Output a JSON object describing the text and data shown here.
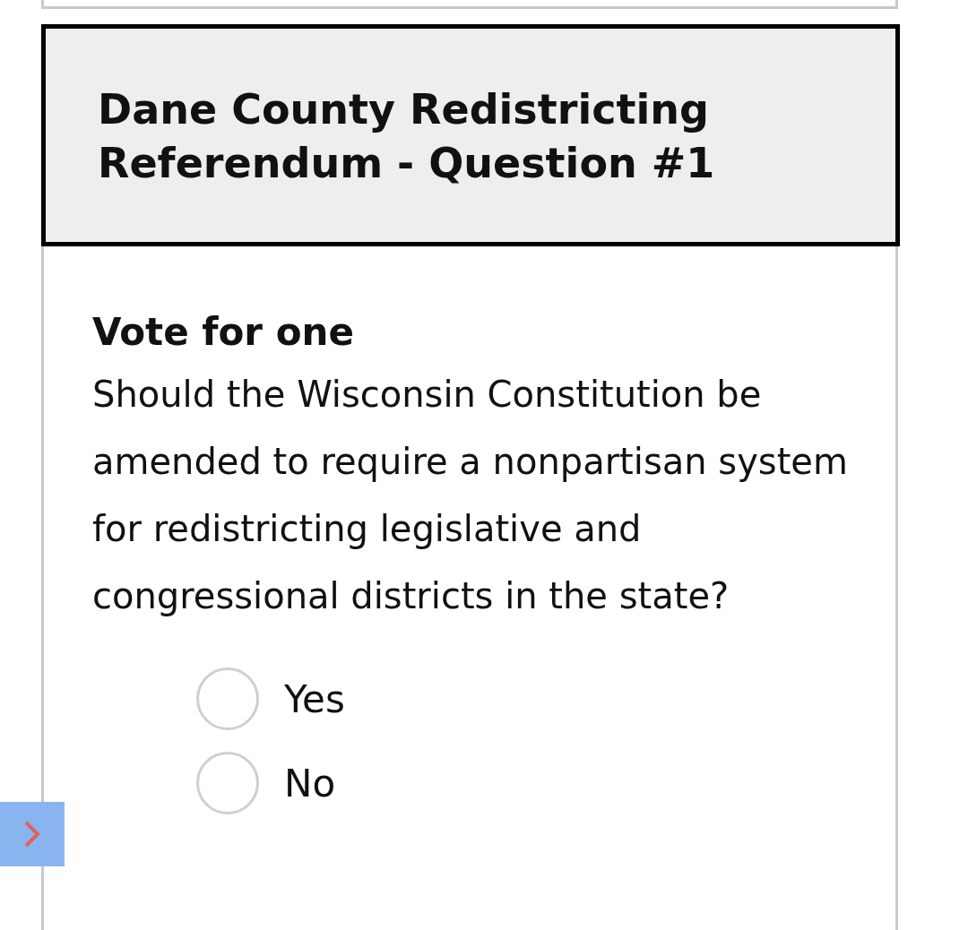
{
  "contest": {
    "title": "Dane County Redistricting Referendum - Question #1",
    "instruction": "Vote for one",
    "question": "Should the Wisconsin Constitution be amended to require a nonpartisan system for redistricting legislative and congressional districts in the state?",
    "options": [
      {
        "label": "Yes",
        "selected": false
      },
      {
        "label": "No",
        "selected": false
      }
    ]
  }
}
